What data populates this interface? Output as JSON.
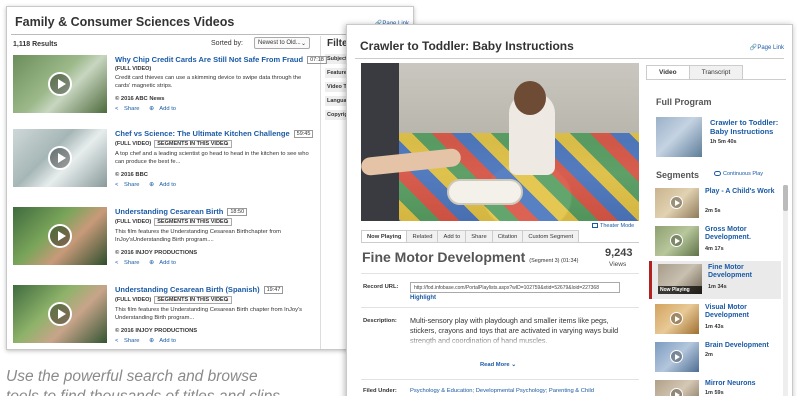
{
  "left": {
    "title": "Family & Consumer Sciences Videos",
    "page_link": "Page Link",
    "results_count": "1,118 Results",
    "sorted_label": "Sorted by:",
    "sorted_value": "Newest to Old...",
    "filter_heading": "Filter",
    "filter_items": [
      "Subject",
      "Feature",
      "Video T",
      "Langua",
      "Copyrig"
    ],
    "results": [
      {
        "title": "Why Chip Credit Cards Are Still Not Safe From Fraud",
        "duration": "07:18",
        "badge": "(FULL VIDEO)",
        "segments": "",
        "description": "Credit card thieves can use a skimming device to swipe data through the cards' magnetic strips.",
        "publisher": "© 2016 ABC News",
        "share": "Share",
        "add": "Add to"
      },
      {
        "title": "Chef vs Science: The Ultimate Kitchen Challenge",
        "duration": "59:45",
        "badge": "(FULL VIDEO)",
        "segments": "SEGMENTS IN THIS VIDEO",
        "description": "A top chef and a leading scientist go head to head in the kitchen to see who can produce the best fe...",
        "publisher": "© 2016 BBC",
        "share": "Share",
        "add": "Add to"
      },
      {
        "title": "Understanding Cesarean Birth",
        "duration": "18:50",
        "badge": "(FULL VIDEO)",
        "segments": "SEGMENTS IN THIS VIDEO",
        "description": "This film features the Understanding Cesarean Birthchapter from InJoy'sUnderstanding Birth program....",
        "publisher": "© 2016 INJOY PRODUCTIONS",
        "share": "Share",
        "add": "Add to"
      },
      {
        "title": "Understanding Cesarean Birth (Spanish)",
        "duration": "19:47",
        "badge": "(FULL VIDEO)",
        "segments": "SEGMENTS IN THIS VIDEO",
        "description": "This film features the Understanding Cesarean Birth chapter from InJoy's Understanding Birth program...",
        "publisher": "© 2016 INJOY PRODUCTIONS",
        "share": "Share",
        "add": "Add to"
      }
    ],
    "caption_line1": "Use the powerful search and browse",
    "caption_line2": "tools to find thousands of titles and clips"
  },
  "right": {
    "title": "Crawler to Toddler: Baby Instructions",
    "page_link": "Page Link",
    "theater_mode": "Theater Mode",
    "tabs": [
      "Now Playing",
      "Related",
      "Add to",
      "Share",
      "Citation",
      "Custom Segment"
    ],
    "segment_title": "Fine Motor Development",
    "segment_meta": "(Segment 3) (01:34)",
    "views_count": "9,243",
    "views_label": "Views",
    "record_url_label": "Record URL:",
    "record_url": "http://fod.infobase.com/PortalPlaylists.aspx?wID=102759&xtid=52679&loid=227368",
    "highlight": "Highlight",
    "description_label": "Description:",
    "description": "Multi-sensory play with playdough and smaller items like pegs, stickers, crayons and toys that are activated in varying ways build strength and coordination of hand muscles.",
    "read_more": "Read More",
    "filed_under_label": "Filed Under:",
    "filed_under": "Psychology & Education; Developmental Psychology; Parenting & Child",
    "sidebar_tabs": [
      "Video",
      "Transcript"
    ],
    "full_program_heading": "Full Program",
    "full_program": {
      "title": "Crawler to Toddler: Baby Instructions",
      "duration": "1h 5m 40s"
    },
    "segments_heading": "Segments",
    "continuous_play": "Continuous Play",
    "now_playing_badge": "Now Playing",
    "segments": [
      {
        "title": "Play - A Child's Work",
        "duration": "2m 5s"
      },
      {
        "title": "Gross Motor Development.",
        "duration": "4m 17s"
      },
      {
        "title": "Fine Motor Development",
        "duration": "1m 34s"
      },
      {
        "title": "Visual Motor Development",
        "duration": "1m 43s"
      },
      {
        "title": "Brain Development",
        "duration": "2m"
      },
      {
        "title": "Mirror Neurons",
        "duration": "1m 59s"
      }
    ]
  },
  "colors": {
    "link": "#1a5aa5",
    "current_segment": "#b22020",
    "caption": "#8a8a8a"
  }
}
